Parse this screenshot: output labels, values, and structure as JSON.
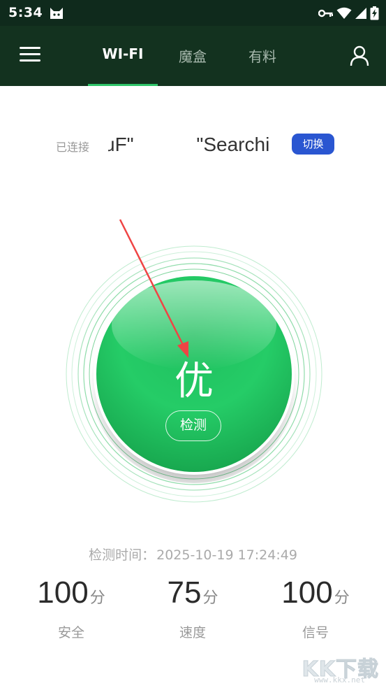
{
  "status_bar": {
    "time": "5:34"
  },
  "nav": {
    "tabs": [
      {
        "label": "WI-FI",
        "active": true
      },
      {
        "label": "魔盒",
        "active": false
      },
      {
        "label": "有料",
        "active": false
      }
    ]
  },
  "connection": {
    "label": "已连接",
    "ssid_left": "uF\"",
    "ssid_right": "\"Searchi",
    "switch_label": "切换"
  },
  "gauge": {
    "grade": "优",
    "detect_label": "检测",
    "color_top": "#22c55e",
    "color_bottom": "#16a34a"
  },
  "check_time": {
    "label": "检测时间：",
    "value": "2025-10-19 17:24:49"
  },
  "stats": [
    {
      "value": "100",
      "unit": "分",
      "label": "安全"
    },
    {
      "value": "75",
      "unit": "分",
      "label": "速度"
    },
    {
      "value": "100",
      "unit": "分",
      "label": "信号"
    }
  ],
  "watermark": {
    "title": "KK下载",
    "url": "www.kkx.net"
  },
  "colors": {
    "app_bar": "#13321f",
    "accent": "#2fc56a",
    "switch_button": "#2a56d1",
    "annotation_arrow": "#ef4444"
  }
}
